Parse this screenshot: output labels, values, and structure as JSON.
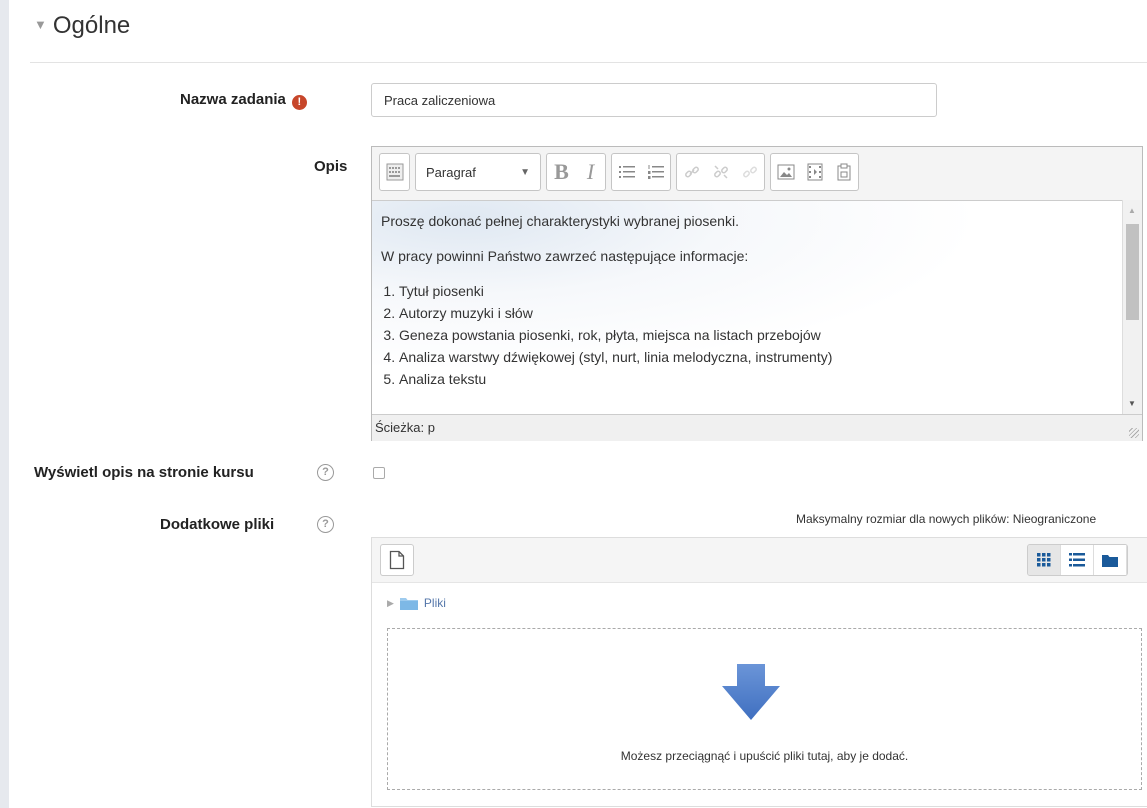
{
  "section": {
    "title": "Ogólne"
  },
  "name_field": {
    "label": "Nazwa zadania",
    "required_icon": "!",
    "value": "Praca zaliczeniowa"
  },
  "description": {
    "label": "Opis",
    "format_select": "Paragraf",
    "paragraphs": [
      "Proszę dokonać pełnej charakterystyki wybranej piosenki.",
      "W pracy powinni Państwo zawrzeć następujące informacje:"
    ],
    "list_items": [
      "Tytuł piosenki",
      "Autorzy muzyki i słów",
      "Geneza powstania piosenki, rok, płyta, miejsca na listach przebojów",
      "Analiza warstwy dźwiękowej (styl, nurt, linia melodyczna, instrumenty)",
      "Analiza tekstu"
    ],
    "path_label": "Ścieżka: p"
  },
  "show_description": {
    "label": "Wyświetl opis na stronie kursu",
    "help_icon": "?",
    "checked": false
  },
  "extra_files": {
    "label": "Dodatkowe pliki",
    "help_icon": "?",
    "max_size": "Maksymalny rozmiar dla nowych plików: Nieograniczone",
    "folder_label": "Pliki",
    "drop_text": "Możesz przeciągnąć i upuścić pliki tutaj, aby je dodać."
  },
  "colors": {
    "required": "#c7462a",
    "arrow": "#4f7fcb",
    "folder": "#1a5a9a",
    "link": "#5577aa"
  }
}
